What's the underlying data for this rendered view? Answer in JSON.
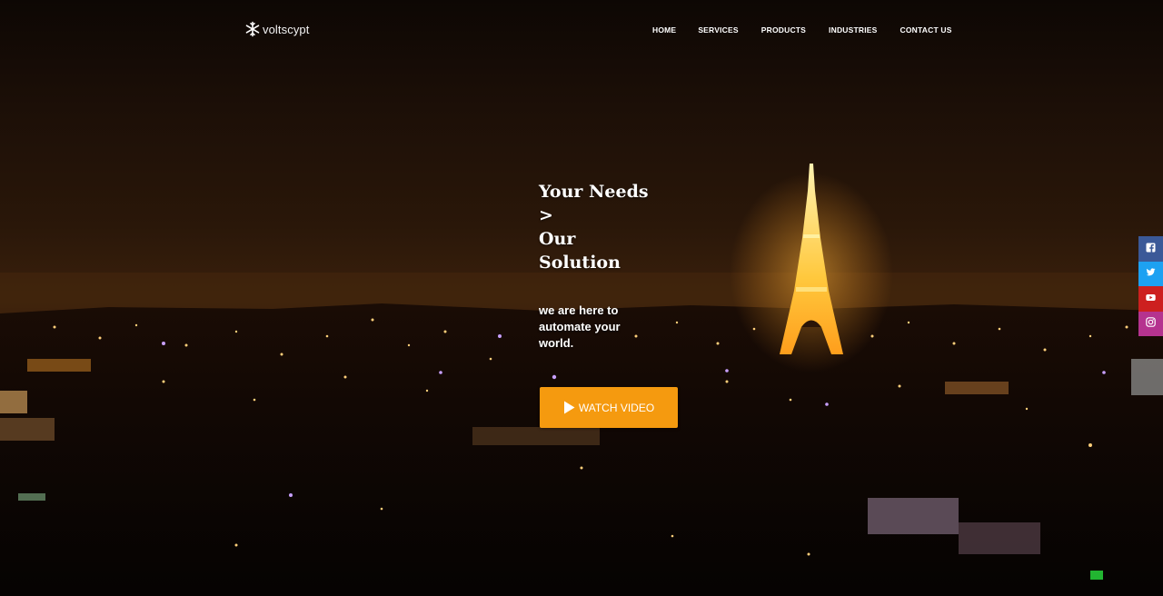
{
  "brand": {
    "name": "voltscypt",
    "icon": "snowflake-icon"
  },
  "nav": {
    "items": [
      {
        "label": "HOME"
      },
      {
        "label": "SERVICES"
      },
      {
        "label": "PRODUCTS"
      },
      {
        "label": "INDUSTRIES"
      },
      {
        "label": "CONTACT US"
      }
    ]
  },
  "hero": {
    "title_lines": [
      "Your Needs",
      ">",
      "Our",
      "Solution"
    ],
    "subtitle": "we are here to automate your world.",
    "cta_label": "WATCH VIDEO",
    "cta_icon": "play-icon",
    "background": "night-city-eiffel-tower"
  },
  "social": [
    {
      "name": "facebook",
      "icon": "facebook-icon",
      "color": "#3b5998"
    },
    {
      "name": "twitter",
      "icon": "twitter-icon",
      "color": "#1da1f2"
    },
    {
      "name": "youtube",
      "icon": "youtube-icon",
      "color": "#cd201f"
    },
    {
      "name": "instagram",
      "icon": "instagram-icon",
      "color": "#b5338f"
    }
  ],
  "colors": {
    "accent": "#f59a0f",
    "text": "#ffffff"
  }
}
